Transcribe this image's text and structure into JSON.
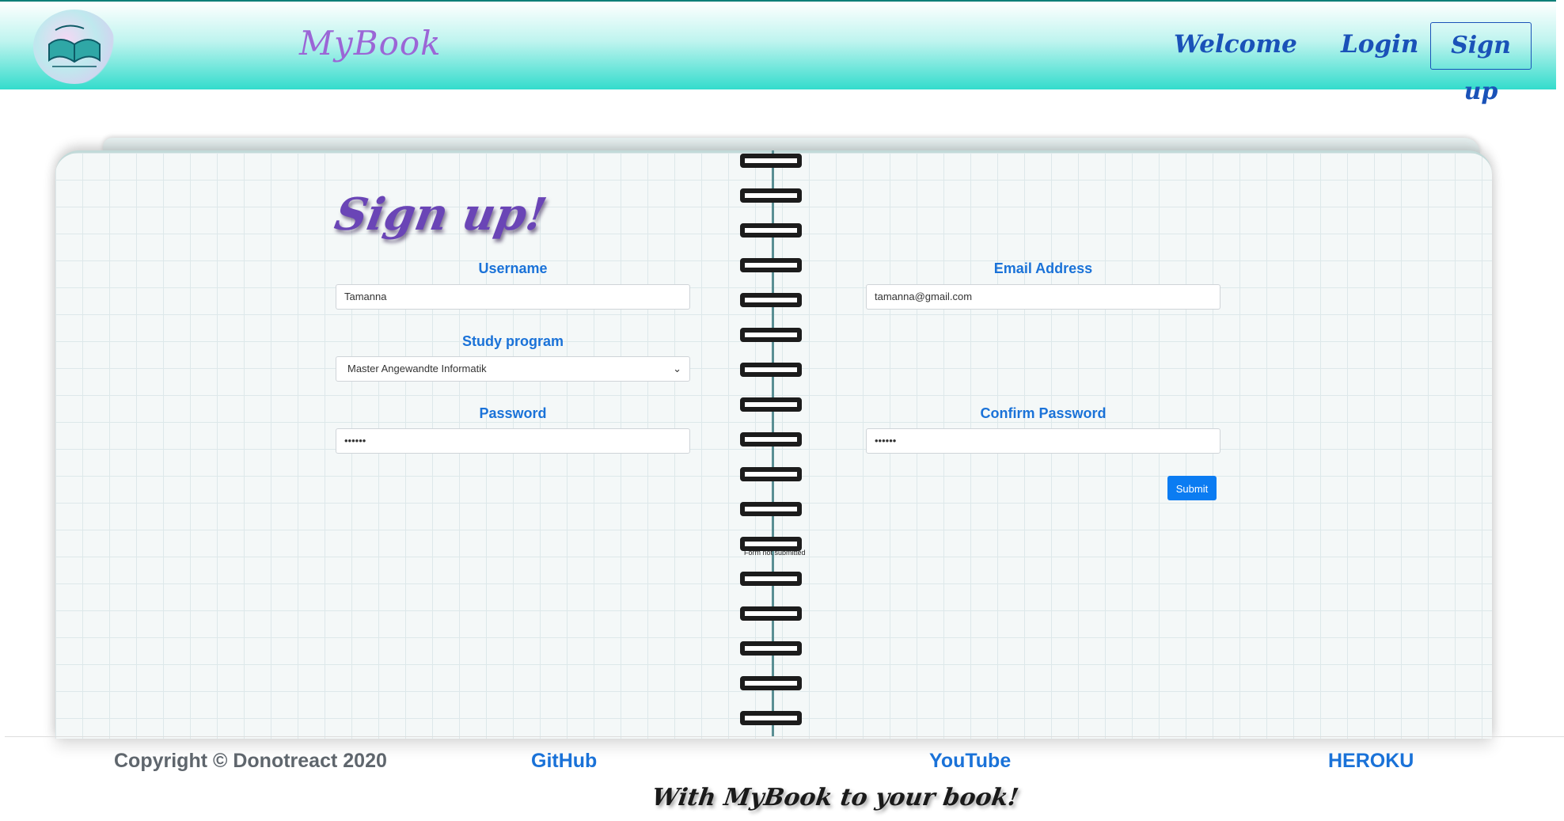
{
  "header": {
    "brand": "MyBook",
    "nav": {
      "welcome": "Welcome",
      "login": "Login",
      "signup": "Sign up"
    }
  },
  "form": {
    "title": "Sign up!",
    "username_label": "Username",
    "username_value": "Tamanna",
    "email_label": "Email Address",
    "email_value": "tamanna@gmail.com",
    "study_label": "Study program",
    "study_value": "Master Angewandte Informatik",
    "password_label": "Password",
    "password_value": "••••••",
    "confirm_label": "Confirm Password",
    "confirm_value": "••••••",
    "submit_label": "Submit",
    "status_text": "Form not submitted"
  },
  "footer": {
    "copyright": "Copyright © Donotreact 2020",
    "github": "GitHub",
    "youtube": "YouTube",
    "heroku": "HEROKU",
    "tagline": "With MyBook to your book!"
  },
  "colors": {
    "accent": "#1a72d8",
    "nav_text": "#1a52b8",
    "button": "#0b7cf2",
    "header_gradient_end": "#33dccc",
    "heading": "#6a45b6"
  },
  "icons": {
    "logo": "book-logo-icon",
    "dropdown": "chevron-down-icon"
  }
}
